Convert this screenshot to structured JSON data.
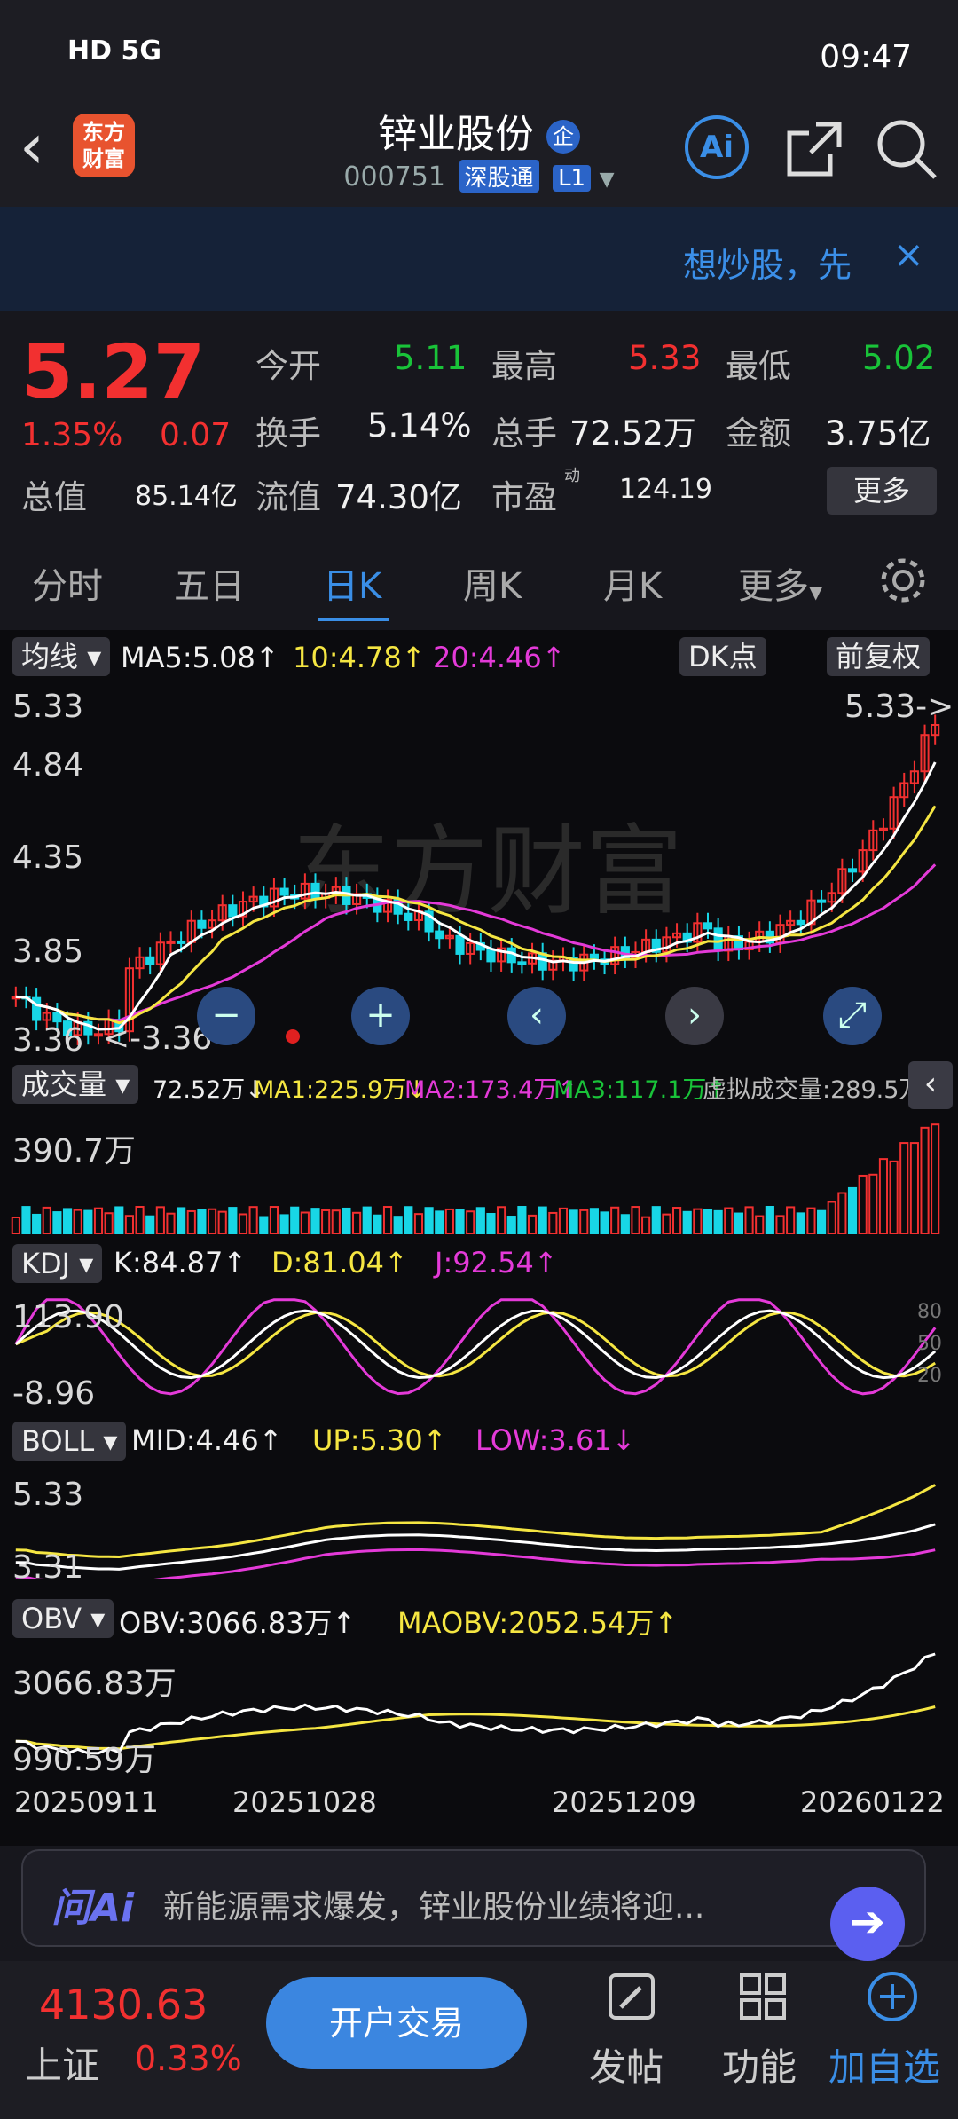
{
  "status": {
    "left": "HD 5G",
    "time": "09:47"
  },
  "header": {
    "logo": "东方财富",
    "title": "锌业股份",
    "badge": "企",
    "code": "000751",
    "market_tag": "深股通",
    "level_tag": "L1",
    "ai_label": "Ai"
  },
  "banner": {
    "text": "想炒股，先",
    "close": "×"
  },
  "quote": {
    "price": "5.27",
    "pct": "1.35%",
    "chg": "0.07",
    "open_l": "今开",
    "open_v": "5.11",
    "high_l": "最高",
    "high_v": "5.33",
    "low_l": "最低",
    "low_v": "5.02",
    "turn_l": "换手",
    "turn_v": "5.14%",
    "vol_l": "总手",
    "vol_v": "72.52万",
    "amt_l": "金额",
    "amt_v": "3.75亿",
    "cap_l": "总值",
    "cap_v": "85.14亿",
    "float_l": "流值",
    "float_v": "74.30亿",
    "pe_l": "市盈",
    "pe_sup": "动",
    "pe_v": "124.19",
    "more": "更多"
  },
  "tabs": [
    "分时",
    "五日",
    "日K",
    "周K",
    "月K",
    "更多"
  ],
  "kline": {
    "ma_btn": "均线",
    "ma5": "MA5:5.08↑",
    "ma10": "10:4.78↑",
    "ma20": "20:4.46↑",
    "dk": "DK点",
    "fq": "前复权",
    "y_top": "5.33",
    "y2": "4.84",
    "y3": "4.35",
    "y4": "3.85",
    "y_bot": "3.36",
    "hi_mark": "5.33->",
    "lo_mark": "<-3.36",
    "watermark": "东方财富"
  },
  "volume": {
    "btn": "成交量",
    "v": "72.52万↓",
    "ma1": "MA1:225.9万↓",
    "ma2": "MA2:173.4万↑",
    "ma3": "MA3:117.1万↑",
    "virtual": "虚拟成交量:289.5万",
    "ymax": "390.7万"
  },
  "kdj": {
    "btn": "KDJ",
    "k": "K:84.87↑",
    "d": "D:81.04↑",
    "j": "J:92.54↑",
    "ytop": "113.90",
    "ybot": "-8.96",
    "r80": "80",
    "r50": "50",
    "r20": "20"
  },
  "boll": {
    "btn": "BOLL",
    "mid": "MID:4.46↑",
    "up": "UP:5.30↑",
    "low": "LOW:3.61↓",
    "ytop": "5.33",
    "ybot": "3.31"
  },
  "obv": {
    "btn": "OBV",
    "obv": "OBV:3066.83万↑",
    "ma": "MAOBV:2052.54万↑",
    "ytop": "3066.83万",
    "ybot": "990.59万"
  },
  "dates": [
    "20250911",
    "20251028",
    "20251209",
    "20260122"
  ],
  "ask": {
    "logo": "问Ai",
    "text": "新能源需求爆发，锌业股份业绩将迎..."
  },
  "nav": {
    "index_v": "4130.63",
    "index_n": "上证",
    "index_p": "0.33%",
    "open": "开户交易",
    "post": "发帖",
    "func": "功能",
    "add": "加自选"
  },
  "colors": {
    "up": "#f23030",
    "down": "#19c339",
    "accent": "#3a8ee6",
    "ma5": "#ffffff",
    "ma10": "#f5e642",
    "ma20": "#e43ad8"
  },
  "icons": [
    "back-icon",
    "share-icon",
    "search-icon",
    "settings-icon",
    "post-icon",
    "grid-icon",
    "add-circle-icon",
    "arrow-right-icon"
  ]
}
